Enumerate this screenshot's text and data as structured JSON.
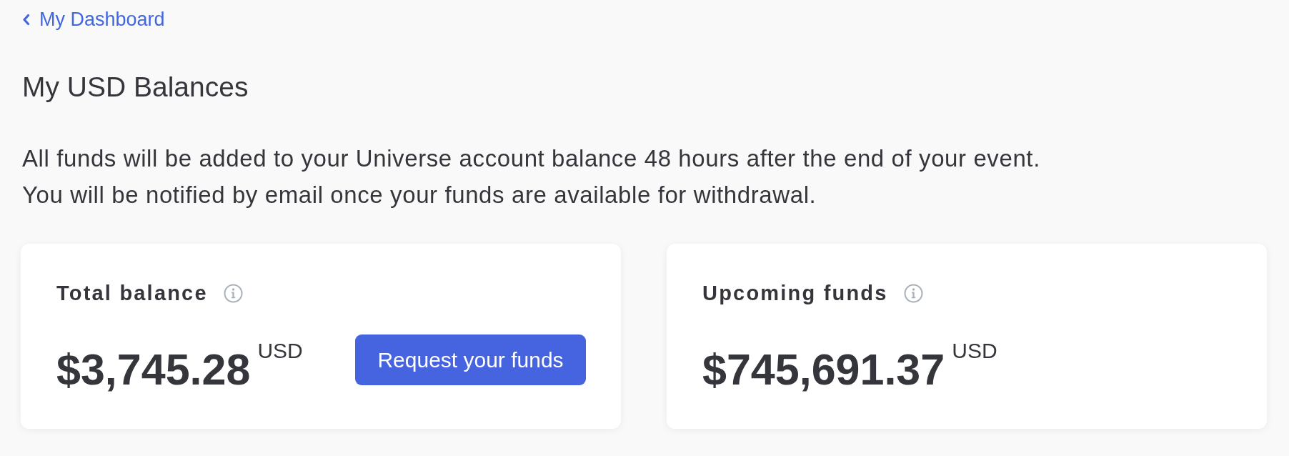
{
  "back_link": {
    "label": "My Dashboard"
  },
  "heading": "My USD Balances",
  "description": [
    "All funds will be added to your Universe account balance 48 hours after the end of your event.",
    "You will be notified by email once your funds are available for withdrawal."
  ],
  "cards": [
    {
      "title": "Total balance",
      "amount": "$3,745.28",
      "currency": "USD",
      "button": {
        "label": "Request your funds"
      }
    },
    {
      "title": "Upcoming funds",
      "amount": "$745,691.37",
      "currency": "USD"
    }
  ]
}
